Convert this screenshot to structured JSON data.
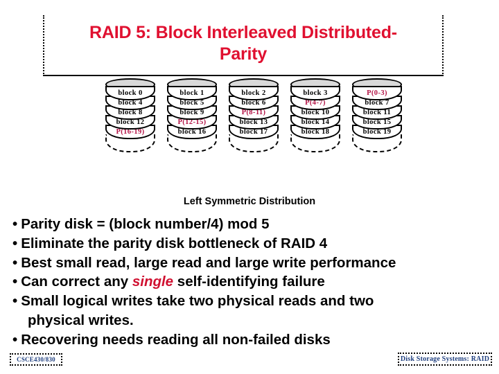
{
  "slide": {
    "title": "RAID 5: Block Interleaved Distributed-\nParity",
    "caption": "Left Symmetric Distribution",
    "title_color": "#e01030",
    "parity_color": "#b31245",
    "footer_color": "#1f3f7f",
    "disk_top_color": "#d9d9d9"
  },
  "disks": [
    {
      "name": "disk-0",
      "cells": [
        {
          "label": "block 0",
          "parity": false
        },
        {
          "label": "block 4",
          "parity": false
        },
        {
          "label": "block 8",
          "parity": false
        },
        {
          "label": "block 12",
          "parity": false
        },
        {
          "label": "P(16-19)",
          "parity": true
        }
      ]
    },
    {
      "name": "disk-1",
      "cells": [
        {
          "label": "block 1",
          "parity": false
        },
        {
          "label": "block 5",
          "parity": false
        },
        {
          "label": "block 9",
          "parity": false
        },
        {
          "label": "P(12-15)",
          "parity": true
        },
        {
          "label": "block 16",
          "parity": false
        }
      ]
    },
    {
      "name": "disk-2",
      "cells": [
        {
          "label": "block 2",
          "parity": false
        },
        {
          "label": "block 6",
          "parity": false
        },
        {
          "label": "P(8-11)",
          "parity": true
        },
        {
          "label": "block 13",
          "parity": false
        },
        {
          "label": "block 17",
          "parity": false
        }
      ]
    },
    {
      "name": "disk-3",
      "cells": [
        {
          "label": "block 3",
          "parity": false
        },
        {
          "label": "P(4-7)",
          "parity": true
        },
        {
          "label": "block 10",
          "parity": false
        },
        {
          "label": "block 14",
          "parity": false
        },
        {
          "label": "block 18",
          "parity": false
        }
      ]
    },
    {
      "name": "disk-4",
      "cells": [
        {
          "label": "P(0-3)",
          "parity": true
        },
        {
          "label": "block 7",
          "parity": false
        },
        {
          "label": "block 11",
          "parity": false
        },
        {
          "label": "block 15",
          "parity": false
        },
        {
          "label": "block 19",
          "parity": false
        }
      ]
    }
  ],
  "bullets": [
    {
      "dot": "•",
      "text": "Parity disk = (block number/4) mod 5",
      "continuation": false
    },
    {
      "dot": "•",
      "text": "Eliminate the parity disk bottleneck of RAID 4",
      "continuation": false
    },
    {
      "dot": "•",
      "text": "Best small read, large read and large write performance",
      "continuation": false
    },
    {
      "dot": "•",
      "pre": "Can correct any ",
      "emphasis": "single",
      "post": " self-identifying failure",
      "continuation": false
    },
    {
      "dot": "•",
      "text": "Small logical writes take two physical reads and two",
      "continuation": false
    },
    {
      "dot": "",
      "text": "physical writes.",
      "continuation": true
    },
    {
      "dot": "•",
      "text": "Recovering needs reading all non-failed disks",
      "continuation": false
    }
  ],
  "footer": {
    "left": "CSCE430/830",
    "right": "Disk Storage Systems: RAID"
  }
}
